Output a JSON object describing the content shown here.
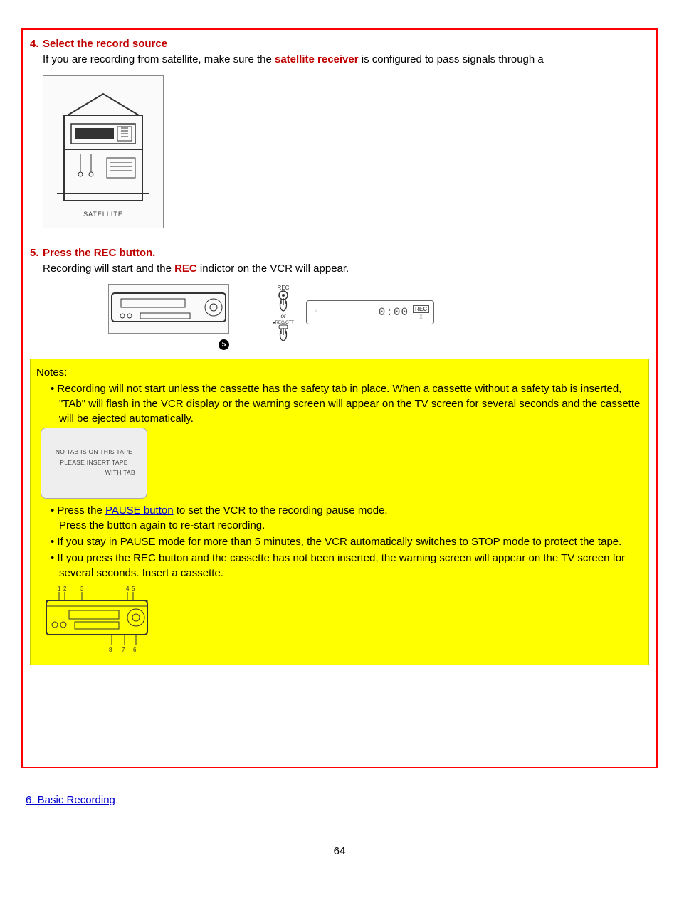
{
  "step4": {
    "num": "4.",
    "title": "Select the record source",
    "line1_pre": "If you are recording from satellite, make sure the ",
    "line1_link": "satellite receiver",
    "line1_post": " is configured to pass signals through a"
  },
  "fig_satellite_caption": "SATELLITE",
  "step5": {
    "num": "5.",
    "title": "Press the REC button.",
    "line_plain1": "Recording will start and the ",
    "line_red": "REC",
    "line_plain2": " indictor on the VCR will appear."
  },
  "lcd": {
    "digits": "0:00",
    "badge": "REC"
  },
  "vcr_circle": "5",
  "hand": {
    "top_label": "REC",
    "mid_label": "or",
    "bottom_label": "●REC/OTT"
  },
  "notes": {
    "title": "Notes:",
    "b1": "Recording will not start unless the cassette has the safety tab in place. When a cassette without a safety tab is inserted, \"TAb\" will flash in the VCR display or the warning screen will appear on the TV screen for several seconds and the cassette will be ejected automatically.",
    "b2a": "Press the ",
    "b2_link": "PAUSE button",
    "b2b": " to set the VCR to the recording pause mode.",
    "b2c": "Press the button again to re-start recording.",
    "b3": "If you stay in PAUSE mode for more than 5 minutes, the VCR automatically switches to STOP mode to protect the tape.",
    "b4": "If you press the REC button and the cassette has not been inserted, the warning screen will appear on the TV screen for several seconds.  Insert a cassette."
  },
  "warn_lines": {
    "l1": "NO TAB IS ON THIS TAPE",
    "l2": "PLEASE INSERT TAPE",
    "l3": "WITH TAB"
  },
  "vcr_labeled_nums": [
    "1",
    "2",
    "3",
    "4",
    "5",
    "6",
    "7",
    "8"
  ],
  "end_link": "6. Basic Recording",
  "page_number": "64"
}
